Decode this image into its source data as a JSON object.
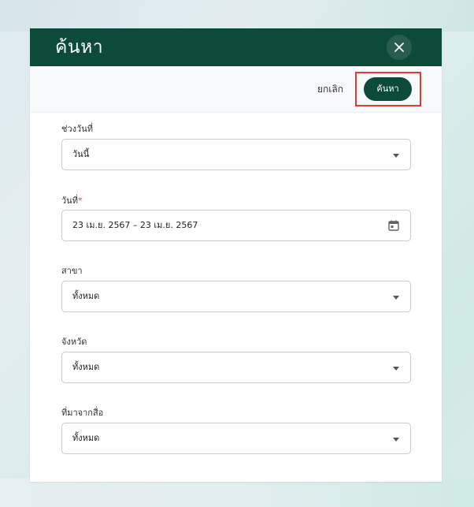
{
  "dialog": {
    "title": "ค้นหา",
    "close_icon": "close-icon"
  },
  "actions": {
    "cancel_label": "ยกเลิก",
    "search_label": "ค้นหา",
    "highlight_color": "#e53935"
  },
  "fields": {
    "date_range": {
      "label": "ช่วงวันที่",
      "value": "วันนี้",
      "icon": "chevron-down-icon"
    },
    "date": {
      "label": "วันที่",
      "required_mark": "*",
      "value": "23 เม.ย. 2567 – 23 เม.ย. 2567",
      "icon": "calendar-icon"
    },
    "branch": {
      "label": "สาขา",
      "value": "ทั้งหมด",
      "icon": "chevron-down-icon"
    },
    "province": {
      "label": "จังหวัด",
      "value": "ทั้งหมด",
      "icon": "chevron-down-icon"
    },
    "source": {
      "label": "ที่มาจากสื่อ",
      "value": "ทั้งหมด",
      "icon": "chevron-down-icon"
    }
  },
  "colors": {
    "header": "#0c4a3a",
    "primary_button": "#0c4a3a",
    "required": "#e53935"
  }
}
